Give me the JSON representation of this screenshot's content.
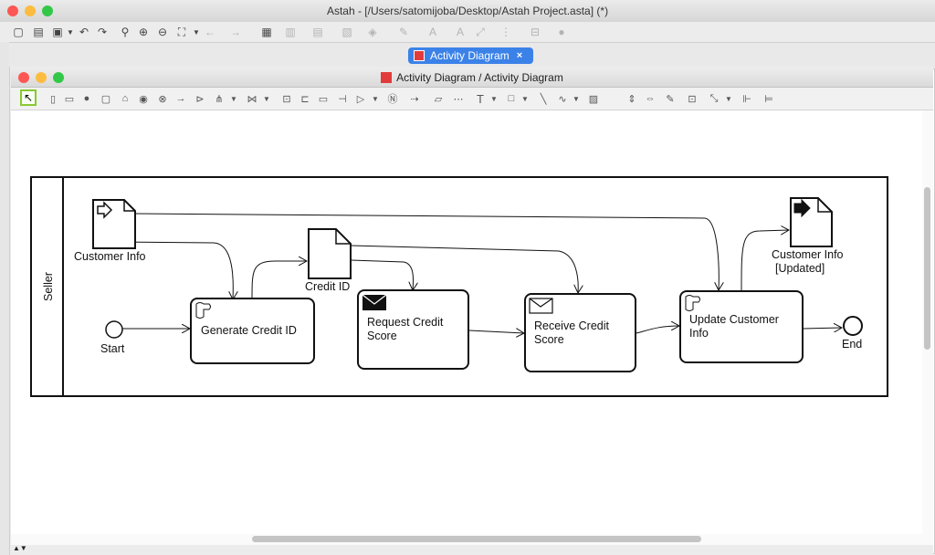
{
  "window": {
    "title": "Astah - [/Users/satomijoba/Desktop/Astah Project.asta] (*)",
    "traffic_lights": {
      "close": "#fc5753",
      "minimize": "#fdbc40",
      "zoom": "#33c748"
    }
  },
  "tab": {
    "label": "Activity Diagram",
    "close": "×"
  },
  "diagram_window": {
    "title": "Activity Diagram / Activity Diagram"
  },
  "diagram": {
    "partition": "Seller",
    "initial": "Start",
    "final": "End",
    "actions": {
      "generate": "Generate Credit ID",
      "request": "Request Credit Score",
      "receive": "Receive Credit Score",
      "update": "Update Customer Info"
    },
    "objects": {
      "customer_info": "Customer Info",
      "credit_id": "Credit ID",
      "customer_info_updated_line1": "Customer Info",
      "customer_info_updated_line2": "[Updated]"
    }
  },
  "colors": {
    "accent": "#3b82e8",
    "select_tool": "#8ac832"
  }
}
